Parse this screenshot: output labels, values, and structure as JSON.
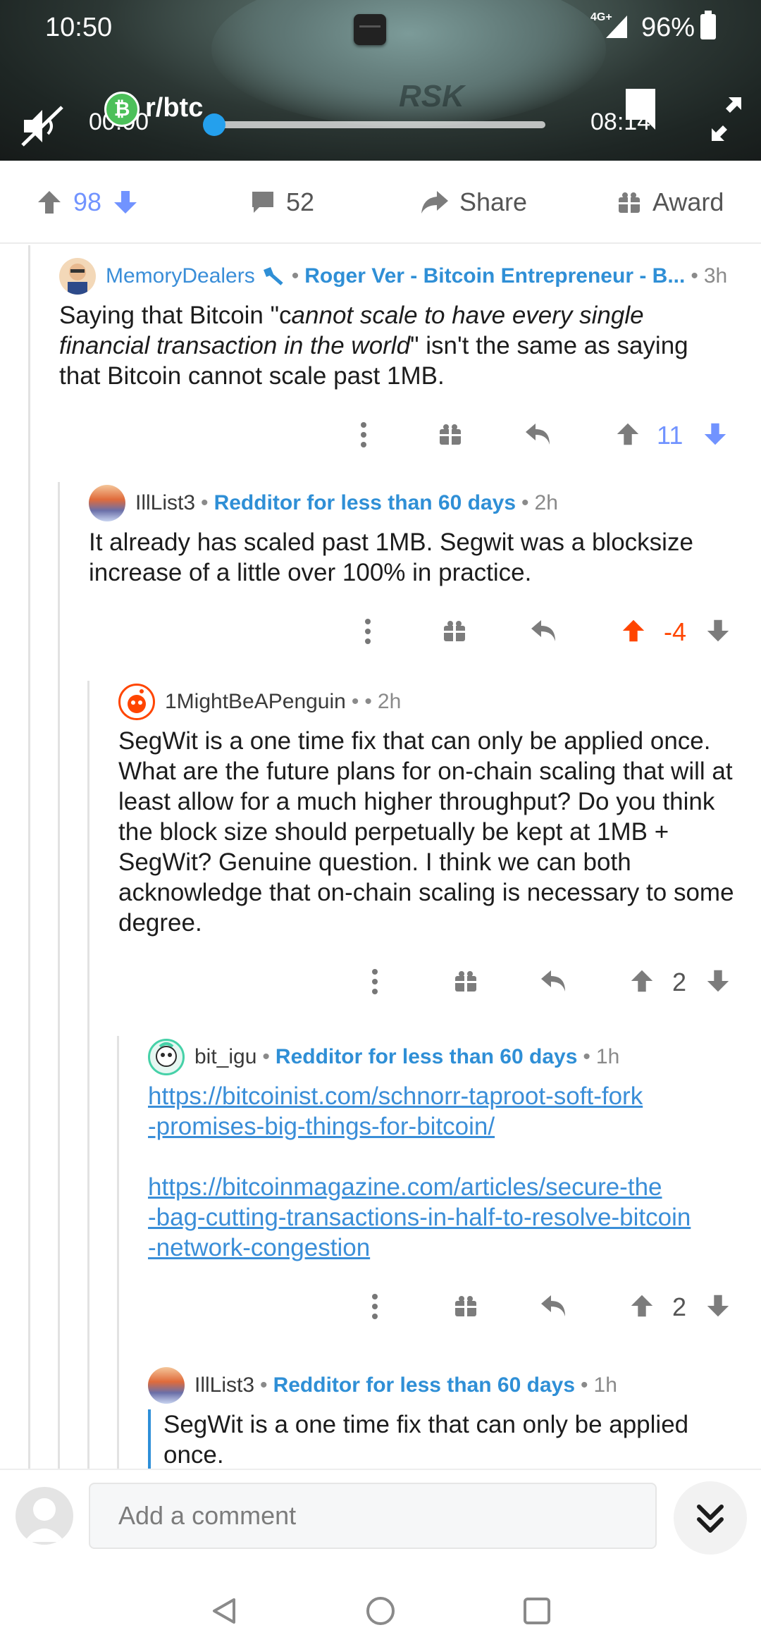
{
  "status_bar": {
    "time": "10:50",
    "network": "4G+",
    "battery": "96%"
  },
  "video": {
    "subreddit": "r/btc",
    "time_start": "00:00",
    "time_end": "08:14",
    "watermark": "RSK"
  },
  "post_actions": {
    "votes": "98",
    "comments": "52",
    "share_label": "Share",
    "award_label": "Award"
  },
  "comments": [
    {
      "user": "MemoryDealers",
      "flair": "Roger Ver - Bitcoin Entrepreneur - B...",
      "age": "3h",
      "body_prefix": "Saying that Bitcoin \"c",
      "body_italic": "annot scale to have every single financial transaction in the world",
      "body_suffix": "\" isn't the same as saying that Bitcoin cannot scale past 1MB.",
      "score": "11"
    },
    {
      "user": "IllList3",
      "flair": "Redditor for less than 60 days",
      "age": "2h",
      "body": "It already has scaled past 1MB.  Segwit was a blocksize increase of a little over 100% in practice.",
      "score": "-4"
    },
    {
      "user": "1MightBeAPenguin",
      "age": "2h",
      "body": "SegWit is a one time fix that can only be applied once. What are the future plans for on-chain scaling that will at least allow for a much higher throughput? Do you think the block size should perpetually be kept at 1MB + SegWit? Genuine question. I think we can both acknowledge that on-chain scaling is necessary to some degree.",
      "score": "2"
    },
    {
      "user": "bit_igu",
      "flair": "Redditor for less than 60 days",
      "age": "1h",
      "links": [
        "https://bitcoinist.com/schnorr-taproot-soft-fork-promises-big-things-for-bitcoin/",
        "https://bitcoinmagazine.com/articles/secure-the-bag-cutting-transactions-in-half-to-resolve-bitcoin-network-congestion"
      ],
      "link_lines": [
        [
          "https://bitcoinist.com/schnorr-taproot-soft-fork",
          "-promises-big-things-for-bitcoin/"
        ],
        [
          "https://bitcoinmagazine.com/articles/secure-the",
          "-bag-cutting-transactions-in-half-to-resolve-bitcoin",
          "-network-congestion"
        ]
      ],
      "score": "2"
    },
    {
      "user": "IllList3",
      "flair": "Redditor for less than 60 days",
      "age": "1h",
      "quote": "SegWit is a one time fix that can only be applied once."
    }
  ],
  "composer": {
    "placeholder": "Add a comment"
  },
  "colors": {
    "upvote_blue": "#7193ff",
    "upvote_orange": "#ff4500",
    "flair_blue": "#2f8fd6",
    "link_blue": "#3a8ed8"
  }
}
